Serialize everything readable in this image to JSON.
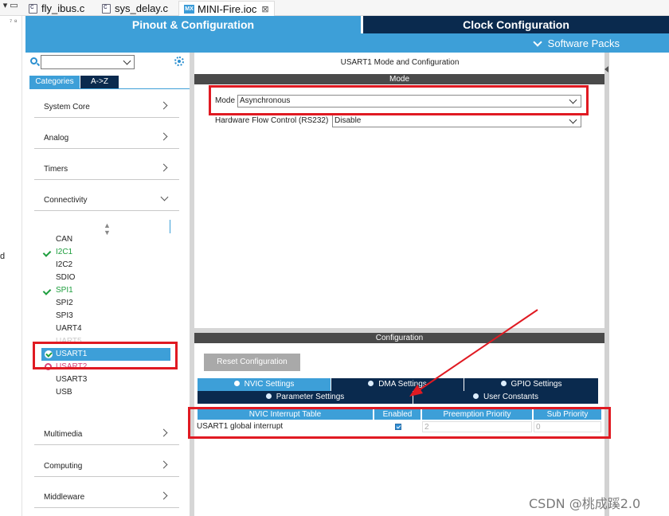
{
  "tabs": {
    "items": [
      {
        "label": "fly_ibus.c"
      },
      {
        "label": "sys_delay.c"
      },
      {
        "label": "MINI-Fire.ioc",
        "icon": "MX",
        "active": true
      }
    ],
    "close": "⊠"
  },
  "left_strip_text": "d",
  "header": {
    "pinout": "Pinout & Configuration",
    "clock": "Clock Configuration",
    "software_packs": "Software Packs"
  },
  "sidebar": {
    "tab_categories": "Categories",
    "tab_az": "A->Z",
    "categories": [
      {
        "label": "System Core",
        "expanded": false
      },
      {
        "label": "Analog",
        "expanded": false
      },
      {
        "label": "Timers",
        "expanded": false
      },
      {
        "label": "Connectivity",
        "expanded": true
      },
      {
        "label": "Multimedia",
        "expanded": false
      },
      {
        "label": "Computing",
        "expanded": false
      },
      {
        "label": "Middleware",
        "expanded": false
      }
    ],
    "peripherals": [
      {
        "label": "CAN",
        "state": "none"
      },
      {
        "label": "I2C1",
        "state": "ok"
      },
      {
        "label": "I2C2",
        "state": "none"
      },
      {
        "label": "SDIO",
        "state": "none"
      },
      {
        "label": "SPI1",
        "state": "ok"
      },
      {
        "label": "SPI2",
        "state": "none"
      },
      {
        "label": "SPI3",
        "state": "none"
      },
      {
        "label": "UART4",
        "state": "none"
      },
      {
        "label": "UART5",
        "state": "faded"
      },
      {
        "label": "USART1",
        "state": "selected"
      },
      {
        "label": "USART2",
        "state": "warning"
      },
      {
        "label": "USART3",
        "state": "none"
      },
      {
        "label": "USB",
        "state": "none"
      }
    ]
  },
  "main": {
    "title": "USART1 Mode and Configuration",
    "mode_bar": "Mode",
    "mode_label": "Mode",
    "mode_value": "Asynchronous",
    "hwflow_label": "Hardware Flow Control (RS232)",
    "hwflow_value": "Disable",
    "config_bar": "Configuration",
    "reset_button": "Reset Configuration",
    "config_tabs": [
      {
        "label": "NVIC Settings",
        "active": true
      },
      {
        "label": "DMA Settings",
        "active": false
      },
      {
        "label": "GPIO Settings",
        "active": false
      },
      {
        "label": "Parameter Settings",
        "active": false
      },
      {
        "label": "User Constants",
        "active": false
      }
    ],
    "nvic_table": {
      "headers": [
        "NVIC Interrupt Table",
        "Enabled",
        "Preemption Priority",
        "Sub Priority"
      ],
      "rows": [
        {
          "name": "USART1 global interrupt",
          "enabled": true,
          "preemption": "2",
          "sub": "0"
        }
      ]
    }
  },
  "watermark": "CSDN @桃成蹊2.0",
  "colors": {
    "accent_blue": "#3d9fd8",
    "navy": "#0a2a4e",
    "highlight_red": "#e01a22",
    "ok_green": "#1e9e3e",
    "warn_pink": "#d8457a"
  }
}
